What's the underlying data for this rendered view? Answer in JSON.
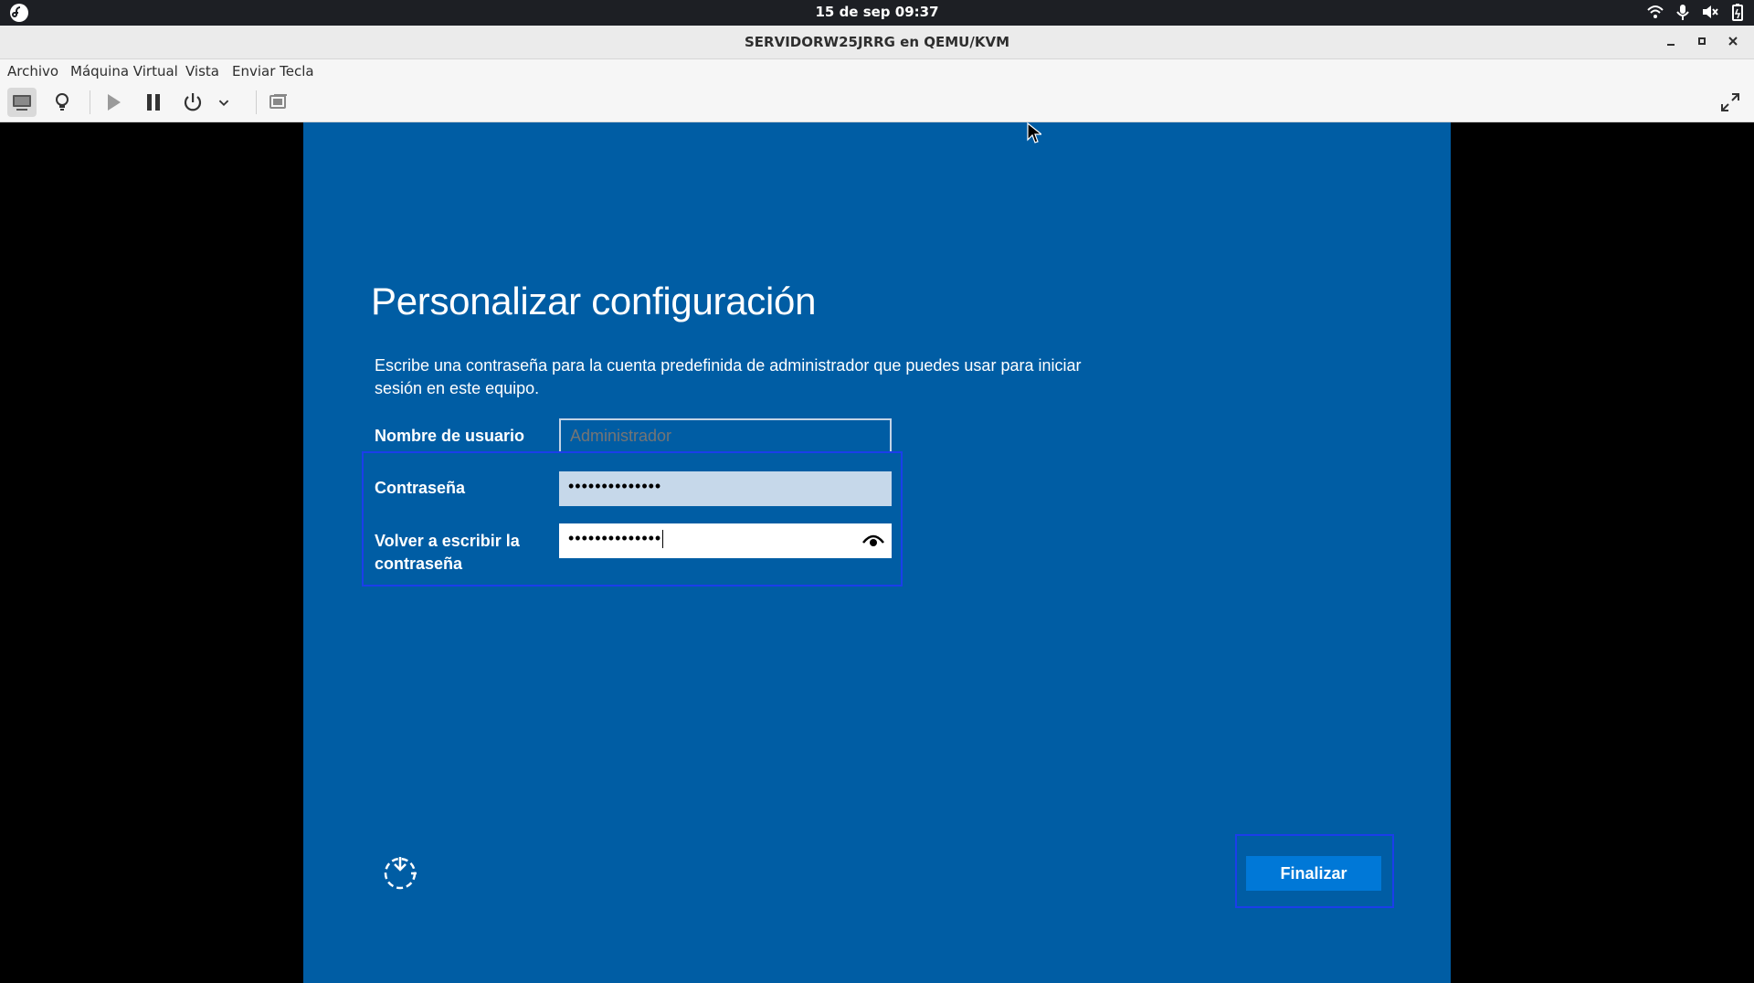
{
  "topbar": {
    "clock": "15 de sep  09:37",
    "tray_icons": [
      "wifi-icon",
      "microphone-icon",
      "volume-muted-icon",
      "battery-icon"
    ]
  },
  "window": {
    "title": "SERVIDORW25JRRG en QEMU/KVM",
    "controls": [
      "minimize-icon",
      "maximize-icon",
      "close-icon"
    ]
  },
  "menubar": {
    "items": [
      "Archivo",
      "Máquina Virtual",
      "Vista",
      "Enviar Tecla"
    ]
  },
  "toolbar": {
    "buttons": [
      "display-icon",
      "lightbulb-icon",
      "play-icon",
      "pause-icon",
      "power-icon",
      "chevron-down-icon",
      "screenshot-icon",
      "fullscreen-icon"
    ]
  },
  "setup": {
    "heading": "Personalizar configuración",
    "description": "Escribe una contraseña para la cuenta predefinida de administrador que puedes usar para iniciar sesión en este equipo.",
    "username_label": "Nombre de usuario",
    "username_placeholder": "Administrador",
    "password_label": "Contraseña",
    "password_value": "••••••••••••••",
    "confirm_label": "Volver a escribir la contraseña",
    "confirm_value": "••••••••••••••",
    "finish_label": "Finalizar"
  },
  "colors": {
    "vm_background": "#005da4",
    "button_blue": "#0078d7",
    "focus_outline": "#1b3eea"
  }
}
